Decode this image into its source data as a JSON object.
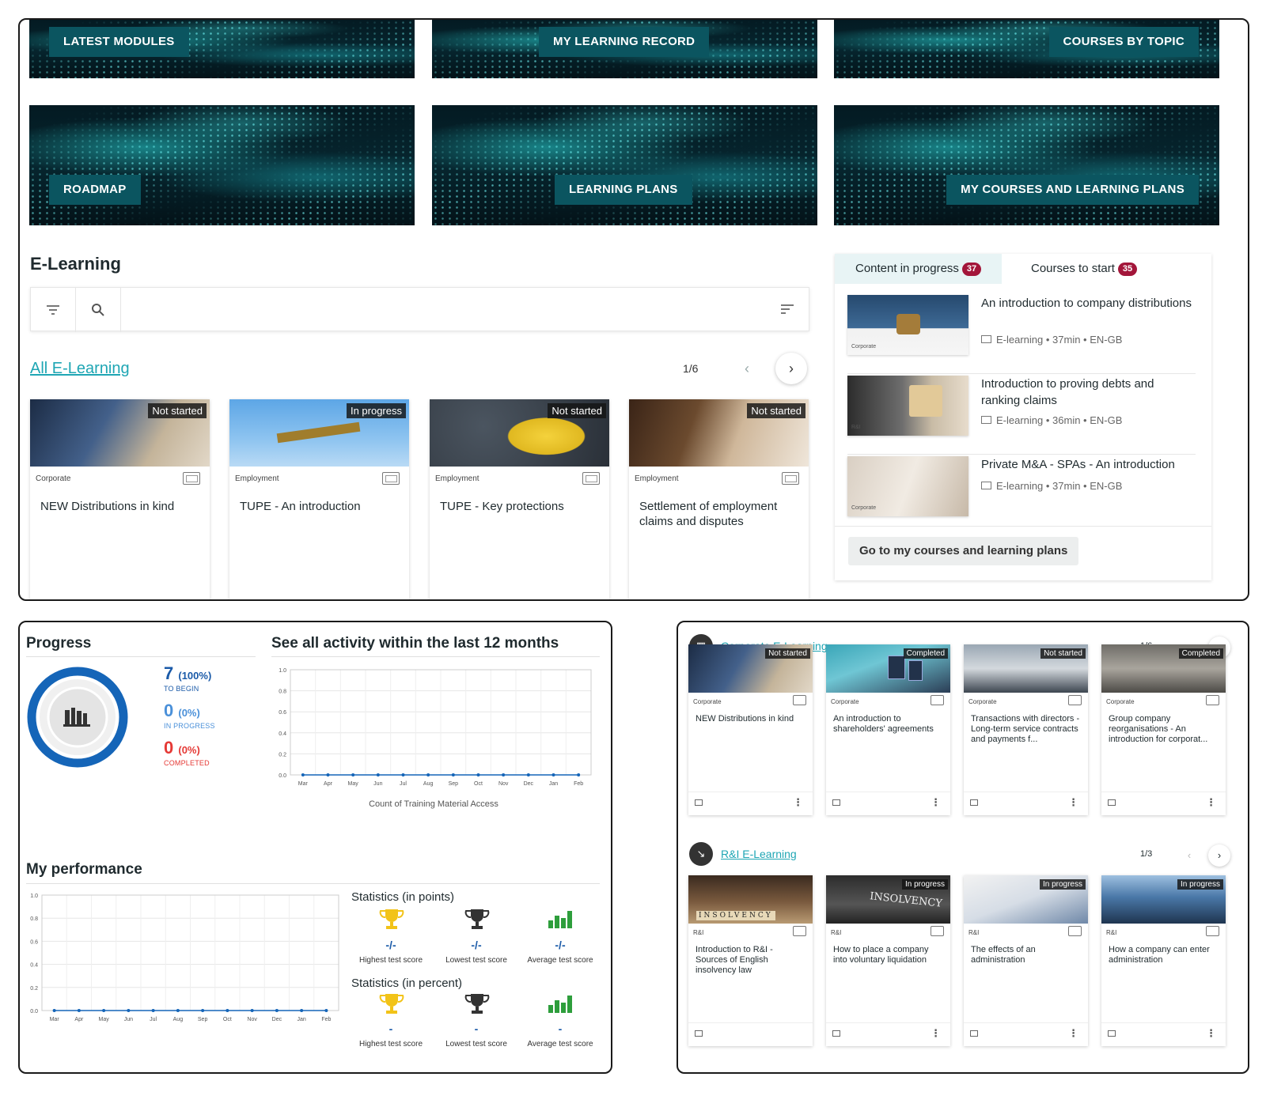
{
  "banners": [
    {
      "label": "LATEST MODULES"
    },
    {
      "label": "MY LEARNING RECORD"
    },
    {
      "label": "COURSES BY TOPIC"
    },
    {
      "label": "ROADMAP"
    },
    {
      "label": "LEARNING PLANS"
    },
    {
      "label": "MY COURSES AND LEARNING PLANS"
    }
  ],
  "elearning": {
    "title": "E-Learning",
    "filter_icon": "filter-icon",
    "search_icon": "search-icon",
    "sort_icon": "sort-icon",
    "all_link": "All E-Learning",
    "pager": "1/6",
    "cards": [
      {
        "status": "Not started",
        "category": "Corporate",
        "title": "NEW Distributions in kind"
      },
      {
        "status": "In progress",
        "category": "Employment",
        "title": "TUPE - An introduction"
      },
      {
        "status": "Not started",
        "category": "Employment",
        "title": "TUPE - Key protections"
      },
      {
        "status": "Not started",
        "category": "Employment",
        "title": "Settlement of employment claims and disputes"
      }
    ]
  },
  "side": {
    "tab_in_progress": "Content in progress",
    "tab_in_progress_count": "37",
    "tab_to_start": "Courses to start",
    "tab_to_start_count": "35",
    "items": [
      {
        "title": "An introduction to company distributions",
        "meta": "E-learning • 37min • EN-GB",
        "category": "Corporate"
      },
      {
        "title": "Introduction to proving debts and ranking claims",
        "meta": "E-learning • 36min • EN-GB",
        "category": "R&I"
      },
      {
        "title": "Private M&A - SPAs - An introduction",
        "meta": "E-learning • 37min • EN-GB",
        "category": "Corporate"
      }
    ],
    "go_button": "Go to my courses and learning plans"
  },
  "progress": {
    "title": "Progress",
    "to_begin_num": "7",
    "to_begin_pct": "(100%)",
    "to_begin_lbl": "TO BEGIN",
    "in_progress_num": "0",
    "in_progress_pct": "(0%)",
    "in_progress_lbl": "IN PROGRESS",
    "completed_num": "0",
    "completed_pct": "(0%)",
    "completed_lbl": "COMPLETED",
    "colors": {
      "begin": "#1a5aa8",
      "progress": "#4a90d9",
      "completed": "#e53935"
    }
  },
  "activity": {
    "title": "See all activity within the last 12 months",
    "caption": "Count of Training Material Access"
  },
  "performance": {
    "title": "My performance",
    "stats_points_title": "Statistics (in points)",
    "stats_percent_title": "Statistics (in percent)",
    "points": [
      {
        "value": "-/-",
        "label": "Highest test score",
        "icon": "gold-trophy-icon"
      },
      {
        "value": "-/-",
        "label": "Lowest test score",
        "icon": "dark-trophy-icon"
      },
      {
        "value": "-/-",
        "label": "Average test score",
        "icon": "bar-chart-icon"
      }
    ],
    "percent": [
      {
        "value": "-",
        "label": "Highest test score",
        "icon": "gold-trophy-icon"
      },
      {
        "value": "-",
        "label": "Lowest test score",
        "icon": "dark-trophy-icon"
      },
      {
        "value": "-",
        "label": "Average test score",
        "icon": "bar-chart-icon"
      }
    ]
  },
  "chart_data": [
    {
      "type": "line",
      "categories": [
        "Mar",
        "Apr",
        "May",
        "Jun",
        "Jul",
        "Aug",
        "Sep",
        "Oct",
        "Nov",
        "Dec",
        "Jan",
        "Feb"
      ],
      "series": [
        {
          "values": [
            0,
            0,
            0,
            0,
            0,
            0,
            0,
            0,
            0,
            0,
            0,
            0
          ]
        }
      ],
      "yticks": [
        "0.0",
        "0.2",
        "0.4",
        "0.6",
        "0.8",
        "1.0"
      ],
      "ylim": [
        0,
        1
      ],
      "xlabel": "Count of Training Material Access",
      "grid": true
    },
    {
      "type": "line",
      "categories": [
        "Mar",
        "Apr",
        "May",
        "Jun",
        "Jul",
        "Aug",
        "Sep",
        "Oct",
        "Nov",
        "Dec",
        "Jan",
        "Feb"
      ],
      "series": [
        {
          "values": [
            0,
            0,
            0,
            0,
            0,
            0,
            0,
            0,
            0,
            0,
            0,
            0
          ]
        }
      ],
      "yticks": [
        "0.0",
        "0.2",
        "0.4",
        "0.6",
        "0.8",
        "1.0"
      ],
      "ylim": [
        0,
        1
      ],
      "grid": true
    }
  ],
  "corporate": {
    "link": "Corporate E-Learning",
    "pager": "1/6",
    "cards": [
      {
        "status": "Not started",
        "category": "Corporate",
        "title": "NEW Distributions in kind"
      },
      {
        "status": "Completed",
        "category": "Corporate",
        "title": "An introduction to shareholders' agreements"
      },
      {
        "status": "Not started",
        "category": "Corporate",
        "title": "Transactions with directors - Long-term service contracts and payments f..."
      },
      {
        "status": "Completed",
        "category": "Corporate",
        "title": "Group company reorganisations - An introduction for corporat..."
      }
    ]
  },
  "ri": {
    "link": "R&I E-Learning",
    "pager": "1/3",
    "cards": [
      {
        "status": "",
        "category": "R&I",
        "title": "Introduction to R&I - Sources of English insolvency law",
        "thumb_text": "INSOLVENCY"
      },
      {
        "status": "In progress",
        "category": "R&I",
        "title": "How to place a company into voluntary liquidation",
        "thumb_text": "INSOLVENCY"
      },
      {
        "status": "In progress",
        "category": "R&I",
        "title": "The effects of an administration"
      },
      {
        "status": "In progress",
        "category": "R&I",
        "title": "How a company can enter administration"
      }
    ]
  }
}
